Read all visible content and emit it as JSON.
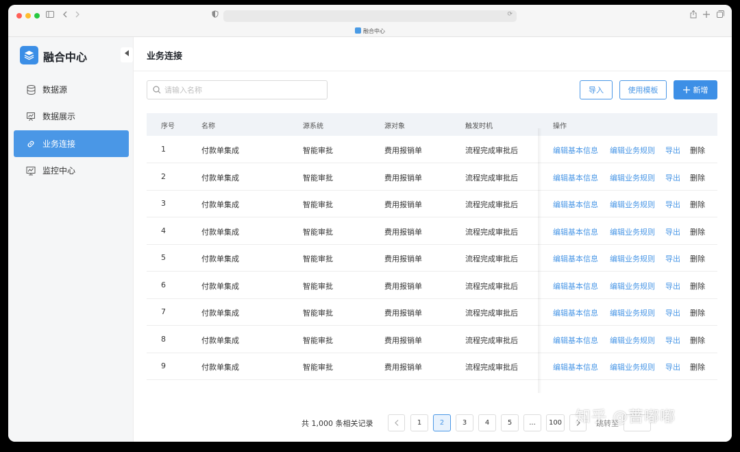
{
  "browser": {
    "tab_title": "融合中心",
    "colors": {
      "close": "#ff5f57",
      "minimize": "#febc2e",
      "maximize": "#28c840"
    }
  },
  "sidebar": {
    "app_name": "融合中心",
    "items": [
      {
        "label": "数据源",
        "icon": "database-icon",
        "active": false
      },
      {
        "label": "数据展示",
        "icon": "presentation-icon",
        "active": false
      },
      {
        "label": "业务连接",
        "icon": "link-icon",
        "active": true
      },
      {
        "label": "监控中心",
        "icon": "monitor-chart-icon",
        "active": false
      }
    ]
  },
  "main": {
    "title": "业务连接",
    "search_placeholder": "请输入名称",
    "buttons": {
      "import": "导入",
      "template": "使用模板",
      "add": "新增"
    },
    "columns": [
      "序号",
      "名称",
      "源系统",
      "源对象",
      "触发时机",
      "操作"
    ],
    "rows": [
      {
        "no": "1",
        "name": "付款单集成",
        "source_system": "智能审批",
        "source_object": "费用报销单",
        "trigger": "流程完成审批后"
      },
      {
        "no": "2",
        "name": "付款单集成",
        "source_system": "智能审批",
        "source_object": "费用报销单",
        "trigger": "流程完成审批后"
      },
      {
        "no": "3",
        "name": "付款单集成",
        "source_system": "智能审批",
        "source_object": "费用报销单",
        "trigger": "流程完成审批后"
      },
      {
        "no": "4",
        "name": "付款单集成",
        "source_system": "智能审批",
        "source_object": "费用报销单",
        "trigger": "流程完成审批后"
      },
      {
        "no": "5",
        "name": "付款单集成",
        "source_system": "智能审批",
        "source_object": "费用报销单",
        "trigger": "流程完成审批后"
      },
      {
        "no": "6",
        "name": "付款单集成",
        "source_system": "智能审批",
        "source_object": "费用报销单",
        "trigger": "流程完成审批后"
      },
      {
        "no": "7",
        "name": "付款单集成",
        "source_system": "智能审批",
        "source_object": "费用报销单",
        "trigger": "流程完成审批后"
      },
      {
        "no": "8",
        "name": "付款单集成",
        "source_system": "智能审批",
        "source_object": "费用报销单",
        "trigger": "流程完成审批后"
      },
      {
        "no": "9",
        "name": "付款单集成",
        "source_system": "智能审批",
        "source_object": "费用报销单",
        "trigger": "流程完成审批后"
      }
    ],
    "actions": {
      "edit_info": "编辑基本信息",
      "edit_rules": "编辑业务规则",
      "export": "导出",
      "delete": "删除"
    }
  },
  "pagination": {
    "total": "共 1,000 条相关记录",
    "pages": [
      "1",
      "2",
      "3",
      "4",
      "5",
      "...",
      "100"
    ],
    "current": "2",
    "goto_label": "跳转至"
  },
  "watermark": "知乎 @蔷嘟嘟",
  "accent_color": "#4a97e6"
}
